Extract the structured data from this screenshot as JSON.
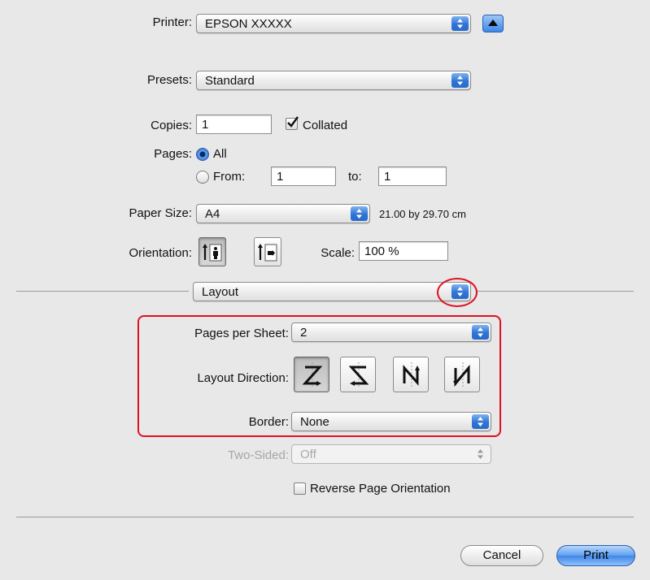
{
  "printer": {
    "label": "Printer:",
    "value": "EPSON XXXXX"
  },
  "presets": {
    "label": "Presets:",
    "value": "Standard"
  },
  "copies": {
    "label": "Copies:",
    "value": "1",
    "collated_label": "Collated",
    "collated": true
  },
  "pages": {
    "label": "Pages:",
    "all_label": "All",
    "from_label": "From:",
    "from_value": "1",
    "to_label": "to:",
    "to_value": "1",
    "selected": "All"
  },
  "paper_size": {
    "label": "Paper Size:",
    "value": "A4",
    "dimensions": "21.00 by 29.70 cm"
  },
  "orientation": {
    "label": "Orientation:",
    "selected": "portrait",
    "icons": [
      "portrait-orientation-icon",
      "landscape-orientation-icon"
    ]
  },
  "scale": {
    "label": "Scale:",
    "value": "100 %"
  },
  "section": {
    "value": "Layout"
  },
  "layout": {
    "pages_per_sheet_label": "Pages per Sheet:",
    "pages_per_sheet_value": "2",
    "direction_label": "Layout Direction:",
    "direction_icons": [
      "z-direction-icon",
      "reverse-z-direction-icon",
      "n-direction-icon",
      "reverse-n-direction-icon"
    ],
    "direction_selected": 0,
    "border_label": "Border:",
    "border_value": "None",
    "two_sided_label": "Two-Sided:",
    "two_sided_value": "Off",
    "reverse_label": "Reverse Page Orientation",
    "reverse_checked": false
  },
  "buttons": {
    "cancel": "Cancel",
    "print": "Print"
  },
  "colors": {
    "accent": "#3f86e8",
    "highlight": "#e01020",
    "background": "#e8e8e8"
  }
}
